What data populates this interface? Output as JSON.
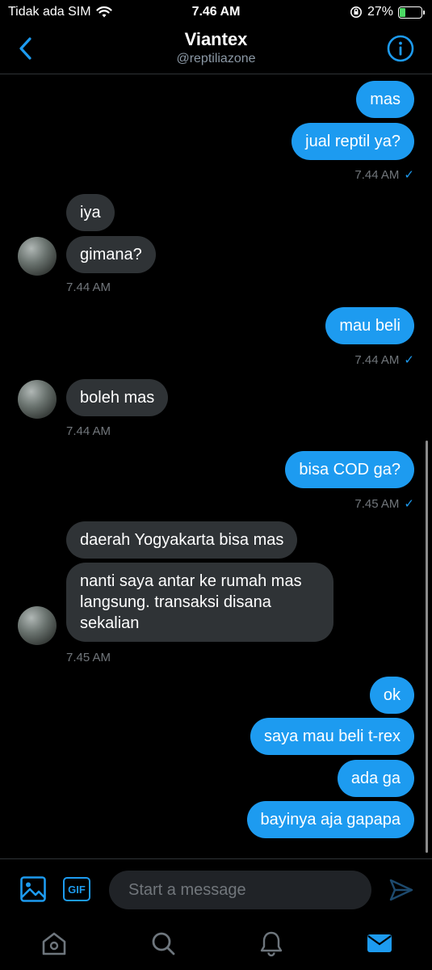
{
  "status": {
    "carrier": "Tidak ada SIM",
    "time": "7.46 AM",
    "battery": "27%",
    "battery_level": 0.27
  },
  "header": {
    "title": "Viantex",
    "handle": "@reptiliazone"
  },
  "messages": [
    {
      "text": "mas"
    },
    {
      "text": "jual reptil ya?"
    },
    {
      "time": "7.44 AM",
      "check": "✓"
    },
    {
      "text": "iya"
    },
    {
      "text": "gimana?"
    },
    {
      "time": "7.44 AM"
    },
    {
      "text": "mau beli"
    },
    {
      "time": "7.44 AM",
      "check": "✓"
    },
    {
      "text": "boleh mas"
    },
    {
      "time": "7.44 AM"
    },
    {
      "text": "bisa COD ga?"
    },
    {
      "time": "7.45 AM",
      "check": "✓"
    },
    {
      "text": "daerah Yogyakarta bisa mas"
    },
    {
      "text": "nanti saya antar ke rumah mas langsung. transaksi disana sekalian"
    },
    {
      "time": "7.45 AM"
    },
    {
      "text": "ok"
    },
    {
      "text": "saya mau beli t-rex"
    },
    {
      "text": "ada ga"
    },
    {
      "text": "bayinya aja gapapa"
    }
  ],
  "composer": {
    "placeholder": "Start a message",
    "gif_label": "GIF"
  },
  "colors": {
    "accent": "#1d9bf0",
    "incoming_bubble": "#2f3336",
    "background": "#000000"
  }
}
